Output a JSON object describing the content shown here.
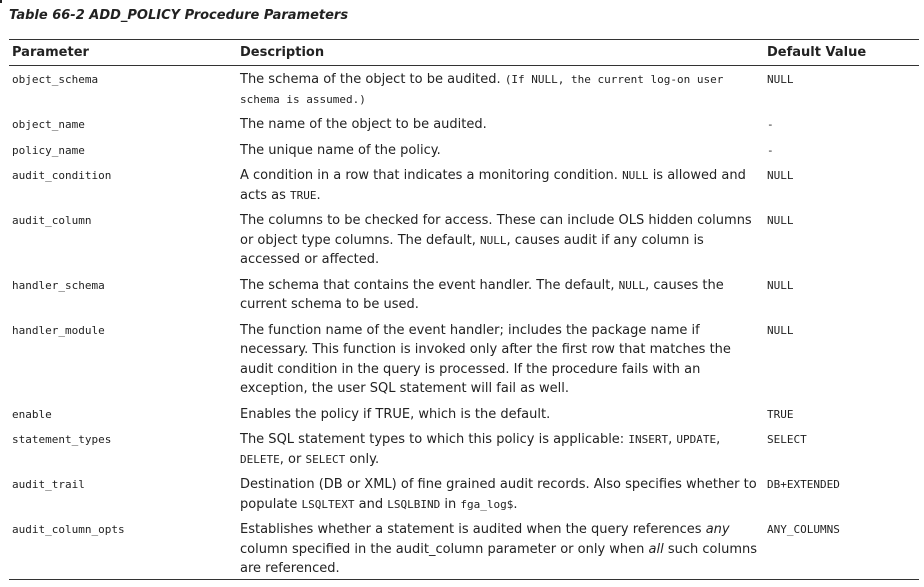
{
  "caption": "Table 66-2 ADD_POLICY Procedure Parameters",
  "headers": [
    "Parameter",
    "Description",
    "Default Value"
  ],
  "rows": [
    {
      "param": "object_schema",
      "desc": [
        {
          "t": "The schema of the object to be audited. "
        },
        {
          "t": "(If NULL, the current log-on user schema is assumed.)",
          "mono": true
        }
      ],
      "default": "NULL"
    },
    {
      "param": "object_name",
      "desc": [
        {
          "t": "The name of the object to be audited."
        }
      ],
      "default": "-"
    },
    {
      "param": "policy_name",
      "desc": [
        {
          "t": "The unique name of the policy."
        }
      ],
      "default": "-"
    },
    {
      "param": "audit_condition",
      "desc": [
        {
          "t": "A condition in a row that indicates a monitoring condition. "
        },
        {
          "t": "NULL",
          "mono": true
        },
        {
          "t": " is allowed and acts as "
        },
        {
          "t": "TRUE",
          "mono": true
        },
        {
          "t": "."
        }
      ],
      "default": "NULL"
    },
    {
      "param": "audit_column",
      "desc": [
        {
          "t": "The columns to be checked for access. These can include OLS hidden columns or object type columns. The default, "
        },
        {
          "t": "NULL",
          "mono": true
        },
        {
          "t": ", causes audit if any column is accessed or affected."
        }
      ],
      "default": "NULL"
    },
    {
      "param": "handler_schema",
      "desc": [
        {
          "t": "The schema that contains the event handler. The default, "
        },
        {
          "t": "NULL",
          "mono": true
        },
        {
          "t": ", causes the current schema to be used."
        }
      ],
      "default": "NULL"
    },
    {
      "param": "handler_module",
      "desc": [
        {
          "t": "The function name of the event handler; includes the package name if necessary. This function is invoked only after the first row that matches the audit condition in the query is processed. If the procedure fails with an exception, the user SQL statement will fail as well."
        }
      ],
      "default": "NULL"
    },
    {
      "param": "enable",
      "desc": [
        {
          "t": "Enables the policy if TRUE, which is the default."
        }
      ],
      "default": "TRUE"
    },
    {
      "param": "statement_types",
      "desc": [
        {
          "t": "The SQL statement types to which this policy is applicable: "
        },
        {
          "t": "INSERT",
          "mono": true
        },
        {
          "t": ", "
        },
        {
          "t": "UPDATE",
          "mono": true
        },
        {
          "t": ", "
        },
        {
          "t": "DELETE",
          "mono": true
        },
        {
          "t": ", or "
        },
        {
          "t": "SELECT",
          "mono": true
        },
        {
          "t": " only."
        }
      ],
      "default": "SELECT"
    },
    {
      "param": "audit_trail",
      "desc": [
        {
          "t": "Destination (DB or XML) of fine grained audit records. Also specifies whether to populate "
        },
        {
          "t": "LSQLTEXT",
          "mono": true
        },
        {
          "t": " and "
        },
        {
          "t": "LSQLBIND",
          "mono": true
        },
        {
          "t": " in "
        },
        {
          "t": "fga_log$",
          "mono": true
        },
        {
          "t": "."
        }
      ],
      "default": "DB+EXTENDED"
    },
    {
      "param": "audit_column_opts",
      "desc": [
        {
          "t": "Establishes whether a statement is audited when the query references "
        },
        {
          "t": "any",
          "em": true
        },
        {
          "t": " column specified in the audit_column parameter or only when "
        },
        {
          "t": "all",
          "em": true
        },
        {
          "t": " such columns are referenced."
        }
      ],
      "default": "ANY_COLUMNS"
    }
  ]
}
